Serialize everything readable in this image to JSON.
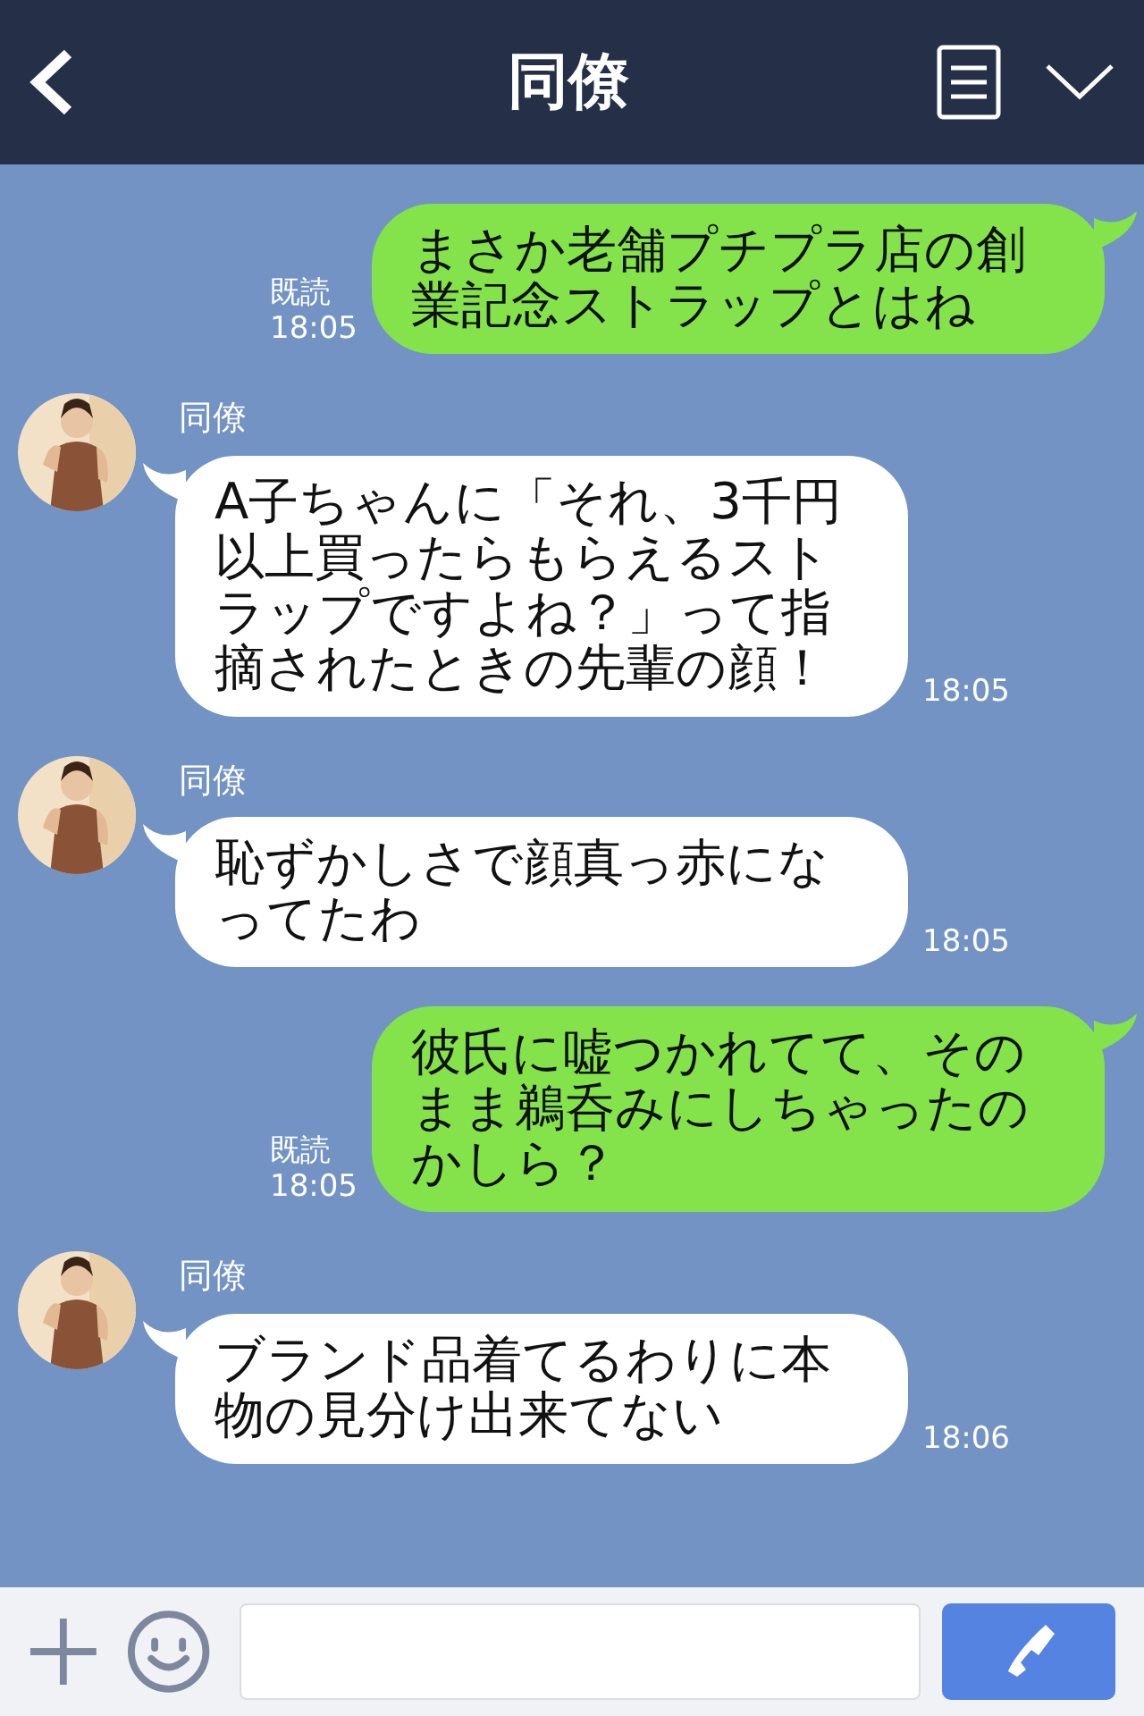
{
  "header": {
    "title": "同僚"
  },
  "messages": [
    {
      "kind": "sent",
      "text": "まさか老舗プチプラ店の創業記念ストラップとはね",
      "read": "既読",
      "time": "18:05"
    },
    {
      "kind": "received",
      "sender": "同僚",
      "text": "A子ちゃんに「それ、3千円以上買ったらもらえるストラップですよね？」って指摘されたときの先輩の顔！",
      "time": "18:05"
    },
    {
      "kind": "received",
      "sender": "同僚",
      "text": "恥ずかしさで顔真っ赤になってたわ",
      "time": "18:05"
    },
    {
      "kind": "sent",
      "text": "彼氏に嘘つかれてて、そのまま鵜呑みにしちゃったのかしら？",
      "read": "既読",
      "time": "18:05"
    },
    {
      "kind": "received",
      "sender": "同僚",
      "text": "ブランド品着てるわりに本物の見分け出来てない",
      "time": "18:06"
    }
  ]
}
